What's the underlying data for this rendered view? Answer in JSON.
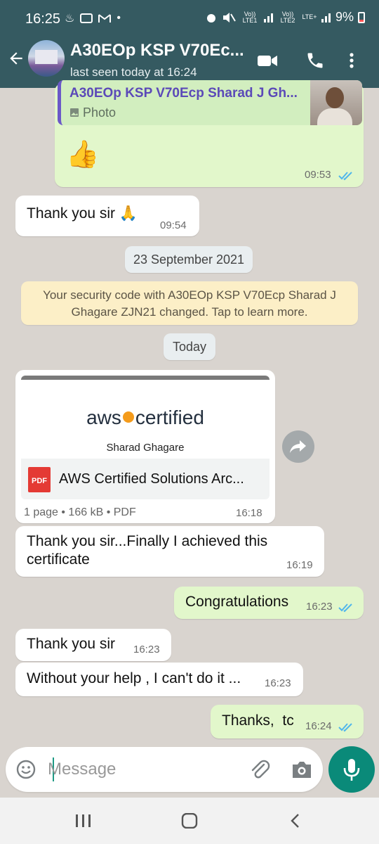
{
  "status_bar": {
    "time": "16:25",
    "battery": "9%",
    "sim1": "Vo)) LTE1",
    "sim2": "Vo)) LTE2",
    "lte": "LTE+"
  },
  "header": {
    "contact_name": "A30EOp KSP V70Ec...",
    "last_seen": "last seen today at 16:24"
  },
  "messages": [
    {
      "dir": "out",
      "quote_name": "A30EOp KSP V70Ecp Sharad J Gh...",
      "quote_type": "Photo",
      "text": "👍",
      "time": "09:53"
    },
    {
      "dir": "in",
      "text": "Thank you sir 🙏",
      "time": "09:54"
    },
    {
      "dir": "in",
      "doc_brand": "aws",
      "doc_brand2": "certified",
      "doc_person": "Sharad Ghagare",
      "doc_title": "AWS Certified Solutions Arc...",
      "doc_meta": "1 page • 166 kB • PDF",
      "doc_icon": "PDF",
      "time": "16:18"
    },
    {
      "dir": "in",
      "text": "Thank you sir...Finally I achieved this certificate",
      "time": "16:19"
    },
    {
      "dir": "out",
      "text": "Congratulations",
      "time": "16:23"
    },
    {
      "dir": "in",
      "text": "Thank you sir",
      "time": "16:23"
    },
    {
      "dir": "in",
      "text": "Without your help , I can't do it ...",
      "time": "16:23"
    },
    {
      "dir": "out",
      "text": "Thanks,  tc",
      "time": "16:24"
    }
  ],
  "date_pill_1": "23 September 2021",
  "security_notice": "Your security code with A30EOp KSP V70Ecp Sharad J Ghagare ZJN21 changed. Tap to learn more.",
  "date_pill_2": "Today",
  "composer": {
    "placeholder": "Message"
  },
  "colors": {
    "header": "#355a61",
    "outgoing": "#e2f7cb",
    "accent": "#0a8a79",
    "ticks": "#4fb6ec"
  },
  "icons": [
    "back-arrow-icon",
    "video-call-icon",
    "voice-call-icon",
    "more-vert-icon",
    "emoji-icon",
    "attach-icon",
    "camera-icon",
    "mic-icon",
    "forward-icon",
    "photo-icon",
    "double-tick-icon"
  ]
}
